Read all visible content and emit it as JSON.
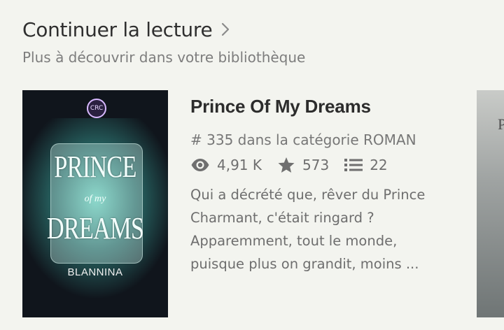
{
  "section": {
    "title": "Continuer la lecture",
    "subtitle": "Plus à découvrir dans votre bibliothèque"
  },
  "story": {
    "title": "Prince Of My Dreams",
    "ranking": "# 335 dans la catégorie ROMAN",
    "reads": "4,91 K",
    "votes": "573",
    "parts": "22",
    "description": "Qui a décrété que, rêver du Prince Charmant, c'était ringard ? Apparemment, tout le monde, puisque plus on grandit, moins ..."
  },
  "cover": {
    "seal": "CRC",
    "title_line1": "PRINCE",
    "title_line2": "of my",
    "title_line3": "DREAMS",
    "author": "BLANNINA"
  },
  "next_cover": {
    "letter": "P"
  },
  "icons": {
    "chevron": "chevron-right-icon",
    "reads": "eye-icon",
    "votes": "star-icon",
    "parts": "list-icon"
  }
}
